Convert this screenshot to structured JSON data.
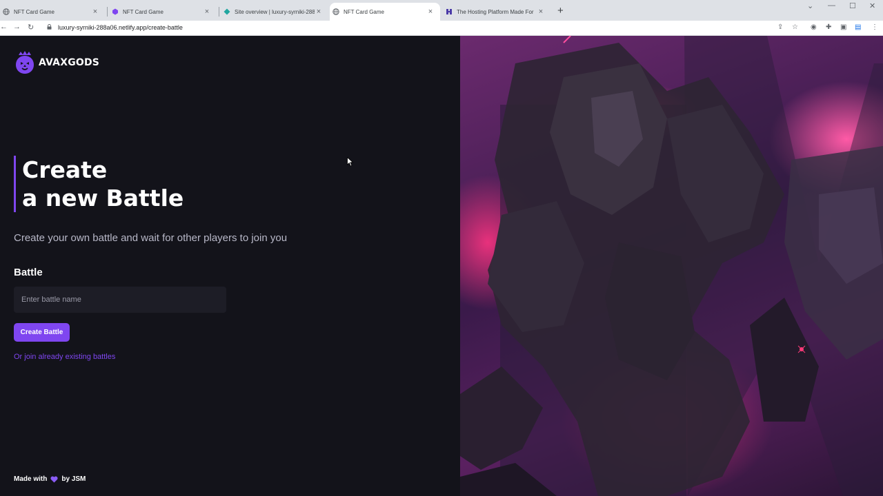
{
  "browser": {
    "tabs": [
      {
        "title": "NFT Card Game",
        "favicon": "globe-icon",
        "active": false
      },
      {
        "title": "NFT Card Game",
        "favicon": "avaxgods-icon",
        "active": false
      },
      {
        "title": "Site overview | luxury-syrniki-288",
        "favicon": "netlify-icon",
        "active": false
      },
      {
        "title": "NFT Card Game",
        "favicon": "globe-icon",
        "active": true
      },
      {
        "title": "The Hosting Platform Made For",
        "favicon": "hosting-icon",
        "active": false
      }
    ],
    "url": "luxury-syrniki-288a06.netlify.app/create-battle"
  },
  "brand": {
    "name": "AVAXGODS",
    "accent_color": "#7f46f0"
  },
  "main": {
    "heading_line1": "Create",
    "heading_line2": "a new Battle",
    "subtitle": "Create your own battle and wait for other players to join you",
    "field_label": "Battle",
    "input_placeholder": "Enter battle name",
    "input_value": "",
    "create_button": "Create Battle",
    "join_link": "Or join already existing battles"
  },
  "footer": {
    "made_with": "Made with",
    "by": "by JSM"
  }
}
